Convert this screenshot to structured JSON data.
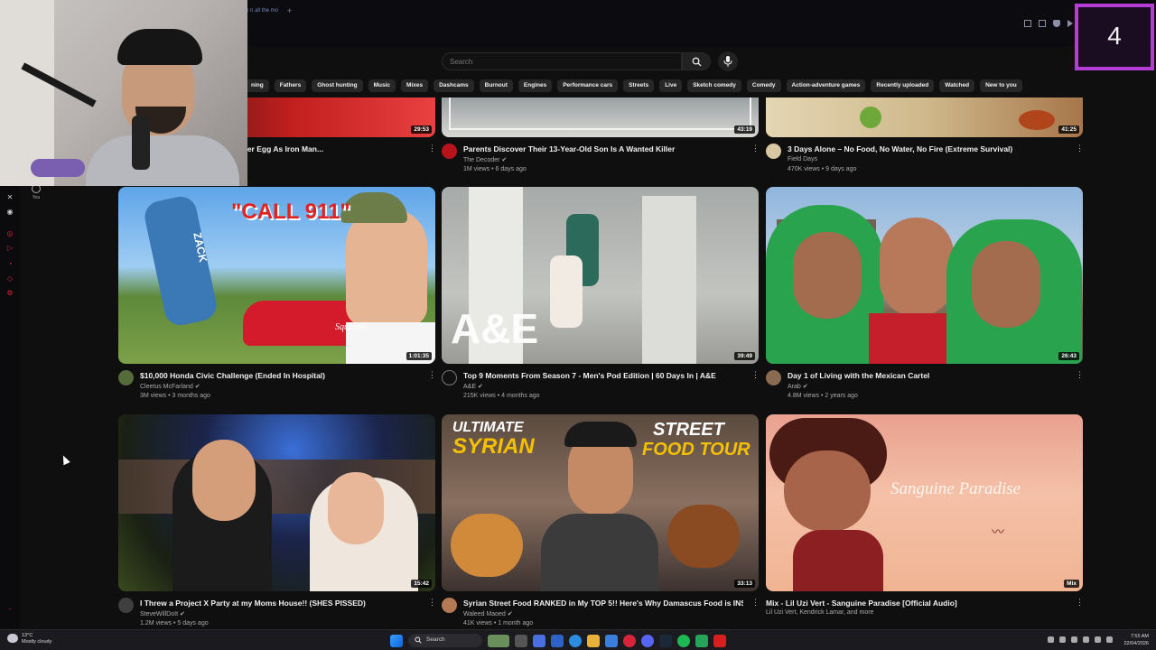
{
  "browser": {
    "tab_title": "e n all the mo",
    "new_tab": "+"
  },
  "score_overlay": "4",
  "search": {
    "placeholder": "Search"
  },
  "chips": [
    "ning",
    "Fathers",
    "Ghost hunting",
    "Music",
    "Mixes",
    "Dashcams",
    "Burnout",
    "Engines",
    "Performance cars",
    "Streets",
    "Live",
    "Sketch comedy",
    "Comedy",
    "Action-adventure games",
    "Recently uploaded",
    "Watched",
    "New to you"
  ],
  "sidebar": {
    "you_label": "You"
  },
  "videos": [
    {
      "title": "ter Egg As Iron Man...",
      "channel": "",
      "stats": "",
      "duration": "29:53"
    },
    {
      "title": "Parents Discover Their 13-Year-Old Son Is A Wanted Killer",
      "channel": "The Decoder ✔",
      "stats": "1M views • 6 days ago",
      "duration": "43:19"
    },
    {
      "title": "3 Days Alone – No Food, No Water, No Fire (Extreme Survival)",
      "channel": "Field Days",
      "stats": "470K views • 9 days ago",
      "duration": "41:25"
    },
    {
      "title": "$10,000 Honda Civic Challenge (Ended In Hospital)",
      "channel": "Cleetus McFarland ✔",
      "stats": "3M views • 3 months ago",
      "duration": "1:01:35",
      "thumb_text_1": "\"CALL 911\"",
      "thumb_text_2": "ZACK",
      "thumb_text_3": "Squirrel"
    },
    {
      "title": "Top 9 Moments From Season 7 - Men's Pod Edition | 60 Days In | A&E",
      "channel": "A&E ✔",
      "stats": "215K views • 4 months ago",
      "duration": "39:49",
      "thumb_text_1": "A&E"
    },
    {
      "title": "Day 1 of Living with the Mexican Cartel",
      "channel": "Arab ✔",
      "stats": "4.8M views • 2 years ago",
      "duration": "26:43"
    },
    {
      "title": "I Threw a Project X Party at my Moms House!! (SHES PISSED)",
      "channel": "SteveWillDoIt ✔",
      "stats": "1.2M views • 5 days ago",
      "duration": "15:42"
    },
    {
      "title": "Syrian Street Food RANKED in My TOP 5!! Here's Why Damascus Food is INSANE",
      "channel": "Waleed Maoed ✔",
      "stats": "41K views • 1 month ago",
      "duration": "33:13",
      "thumb_text_1": "ULTIMATE",
      "thumb_text_2": "SYRIAN",
      "thumb_text_3": "STREET",
      "thumb_text_4": "FOOD TOUR"
    },
    {
      "title": "Mix - Lil Uzi Vert - Sanguine Paradise [Official Audio]",
      "channel": "Lil Uzi Vert, Kendrick Lamar, and more",
      "stats": "",
      "duration": "Mix",
      "thumb_text_1": "Sanguine Paradise"
    }
  ],
  "taskbar": {
    "temperature": "13°C",
    "weather": "Mostly cloudy",
    "search": "Search",
    "time": "7:55 AM",
    "date": "22/04/2026"
  },
  "colors": {
    "accent_overlay": "#b43dd6",
    "yt_background": "#0f0f0f"
  }
}
